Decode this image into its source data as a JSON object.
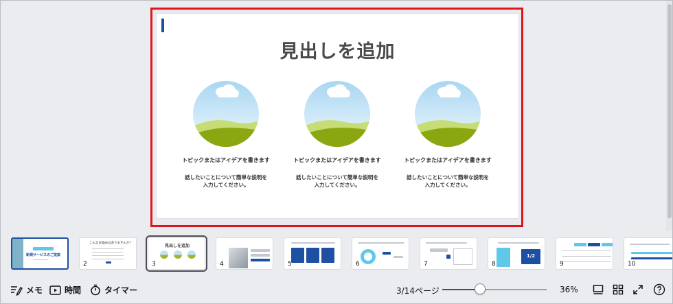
{
  "slide": {
    "heading": "見出しを追加",
    "columns": [
      {
        "title": "トピックまたはアイデアを書きます",
        "desc": "話したいことについて簡単な説明を\n入力してください。"
      },
      {
        "title": "トピックまたはアイデアを書きます",
        "desc": "話したいことについて簡単な説明を\n入力してください。"
      },
      {
        "title": "トピックまたはアイデアを書きます",
        "desc": "話したいことについて簡単な説明を\n入力してください。"
      }
    ]
  },
  "filmstrip": {
    "selected": 3,
    "thumbnails": [
      {
        "num": "",
        "title": "新規サービスのご提案"
      },
      {
        "num": "2",
        "title": "こんなお悩みはありませんか？"
      },
      {
        "num": "3",
        "title": "見出しを追加"
      },
      {
        "num": "4",
        "title": ""
      },
      {
        "num": "5",
        "title": ""
      },
      {
        "num": "6",
        "title": ""
      },
      {
        "num": "7",
        "title": ""
      },
      {
        "num": "8",
        "title": "1/2"
      },
      {
        "num": "9",
        "title": ""
      },
      {
        "num": "10",
        "title": ""
      }
    ]
  },
  "toolbar": {
    "memo_label": "メモ",
    "time_label": "時間",
    "timer_label": "タイマー",
    "page_indicator": "3/14ページ",
    "zoom_percent": "36%",
    "zoom_value": 0.36
  },
  "colors": {
    "accent": "#1d4fa3",
    "highlight": "#e2141b",
    "sky": "#cfe9f8",
    "grass": "#8aa712"
  }
}
